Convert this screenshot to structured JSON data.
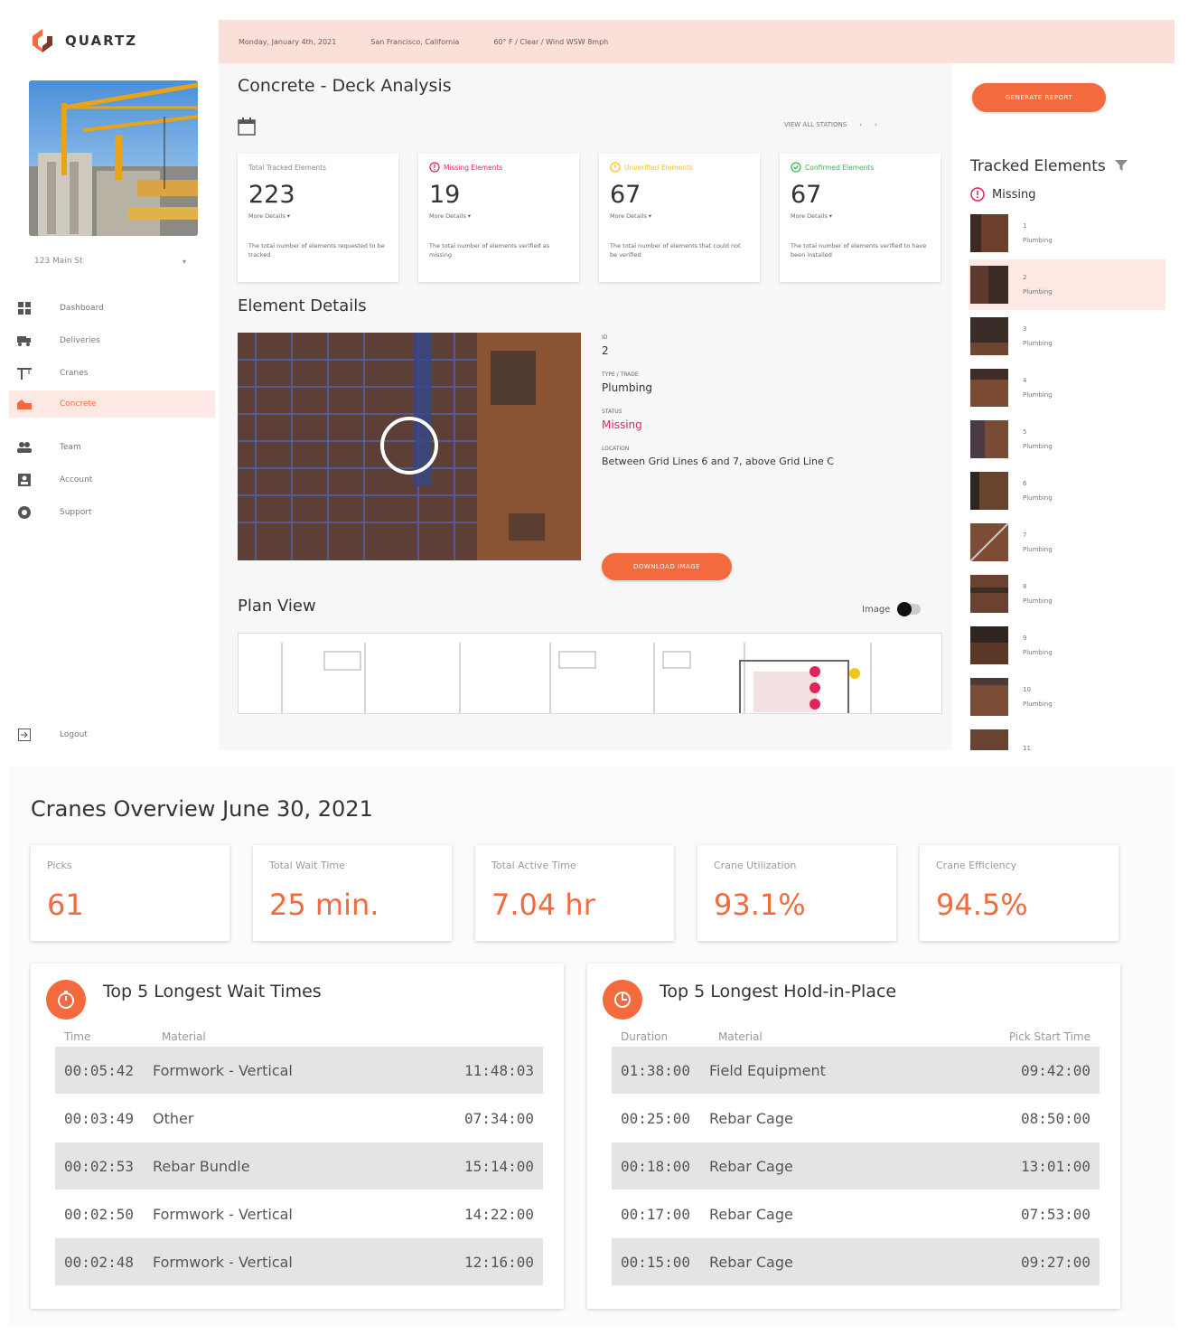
{
  "app": {
    "brand": "QUARTZ",
    "site_select": "123 Main St",
    "nav": [
      {
        "label": "Dashboard",
        "icon": "dashboard-icon"
      },
      {
        "label": "Deliveries",
        "icon": "truck-icon"
      },
      {
        "label": "Cranes",
        "icon": "crane-icon"
      },
      {
        "label": "Concrete",
        "icon": "concrete-icon"
      },
      {
        "label": "Team",
        "icon": "team-icon"
      },
      {
        "label": "Account",
        "icon": "account-icon"
      },
      {
        "label": "Support",
        "icon": "support-icon"
      }
    ],
    "logout": "Logout",
    "topbar": {
      "date": "Monday, January 4th, 2021",
      "location": "San Francisco, California",
      "weather": "60° F / Clear / Wind WSW 8mph"
    }
  },
  "main": {
    "title": "Concrete - Deck Analysis",
    "view_all": "VIEW ALL STATIONS",
    "stats": [
      {
        "label": "Total Tracked Elements",
        "value": "223",
        "more": "More Details",
        "desc": "The total number of elements requested to be tracked",
        "color": "#999999"
      },
      {
        "label": "Missing Elements",
        "value": "19",
        "more": "More Details",
        "desc": "The total number of elements verified as missing",
        "color": "#e0245e"
      },
      {
        "label": "Unverified Elements",
        "value": "67",
        "more": "More Details",
        "desc": "The total number of elements that could not be verified",
        "color": "#f5c518"
      },
      {
        "label": "Confirmed Elements",
        "value": "67",
        "more": "More Details",
        "desc": "The total number of elements verified to have been installed",
        "color": "#3db54a"
      }
    ],
    "details_title": "Element Details",
    "details": {
      "id_label": "ID",
      "id_value": "2",
      "type_label": "TYPE / TRADE",
      "type_value": "Plumbing",
      "status_label": "STATUS",
      "status_value": "Missing",
      "location_label": "LOCATION",
      "location_value": "Between Grid Lines 6 and 7, above Grid Line C",
      "download_label": "DOWNLOAD IMAGE"
    },
    "plan_title": "Plan View",
    "plan_toggle": "Image"
  },
  "right": {
    "generate_label": "GENERATE REPORT",
    "tracked_title": "Tracked Elements",
    "missing_label": "Missing",
    "items": [
      {
        "id": "1",
        "trade": "Plumbing"
      },
      {
        "id": "2",
        "trade": "Plumbing"
      },
      {
        "id": "3",
        "trade": "Plumbing"
      },
      {
        "id": "4",
        "trade": "Plumbing"
      },
      {
        "id": "5",
        "trade": "Plumbing"
      },
      {
        "id": "6",
        "trade": "Plumbing"
      },
      {
        "id": "7",
        "trade": "Plumbing"
      },
      {
        "id": "8",
        "trade": "Plumbing"
      },
      {
        "id": "9",
        "trade": "Plumbing"
      },
      {
        "id": "10",
        "trade": "Plumbing"
      },
      {
        "id": "11",
        "trade": ""
      }
    ]
  },
  "cranes": {
    "title": "Cranes Overview June 30, 2021",
    "kpis": [
      {
        "label": "Picks",
        "value": "61"
      },
      {
        "label": "Total Wait Time",
        "value": "25 min."
      },
      {
        "label": "Total Active Time",
        "value": "7.04 hr"
      },
      {
        "label": "Crane Utilization",
        "value": "93.1%"
      },
      {
        "label": "Crane Efficiency",
        "value": "94.5%"
      }
    ],
    "wait": {
      "title": "Top 5 Longest Wait Times",
      "headers": [
        "Time",
        "Material",
        ""
      ],
      "rows": [
        [
          "00:05:42",
          "Formwork - Vertical",
          "11:48:03"
        ],
        [
          "00:03:49",
          "Other",
          "07:34:00"
        ],
        [
          "00:02:53",
          "Rebar Bundle",
          "15:14:00"
        ],
        [
          "00:02:50",
          "Formwork - Vertical",
          "14:22:00"
        ],
        [
          "00:02:48",
          "Formwork - Vertical",
          "12:16:00"
        ]
      ]
    },
    "hold": {
      "title": "Top 5 Longest Hold-in-Place",
      "headers": [
        "Duration",
        "Material",
        "Pick Start Time"
      ],
      "rows": [
        [
          "01:38:00",
          "Field Equipment",
          "09:42:00"
        ],
        [
          "00:25:00",
          "Rebar Cage",
          "08:50:00"
        ],
        [
          "00:18:00",
          "Rebar Cage",
          "13:01:00"
        ],
        [
          "00:17:00",
          "Rebar Cage",
          "07:53:00"
        ],
        [
          "00:15:00",
          "Rebar Cage",
          "09:27:00"
        ]
      ]
    }
  },
  "colors": {
    "accent": "#f26a3d",
    "missing": "#e0245e",
    "unverified": "#f5c518",
    "confirmed": "#3db54a",
    "header_bg": "#fbe0da"
  }
}
